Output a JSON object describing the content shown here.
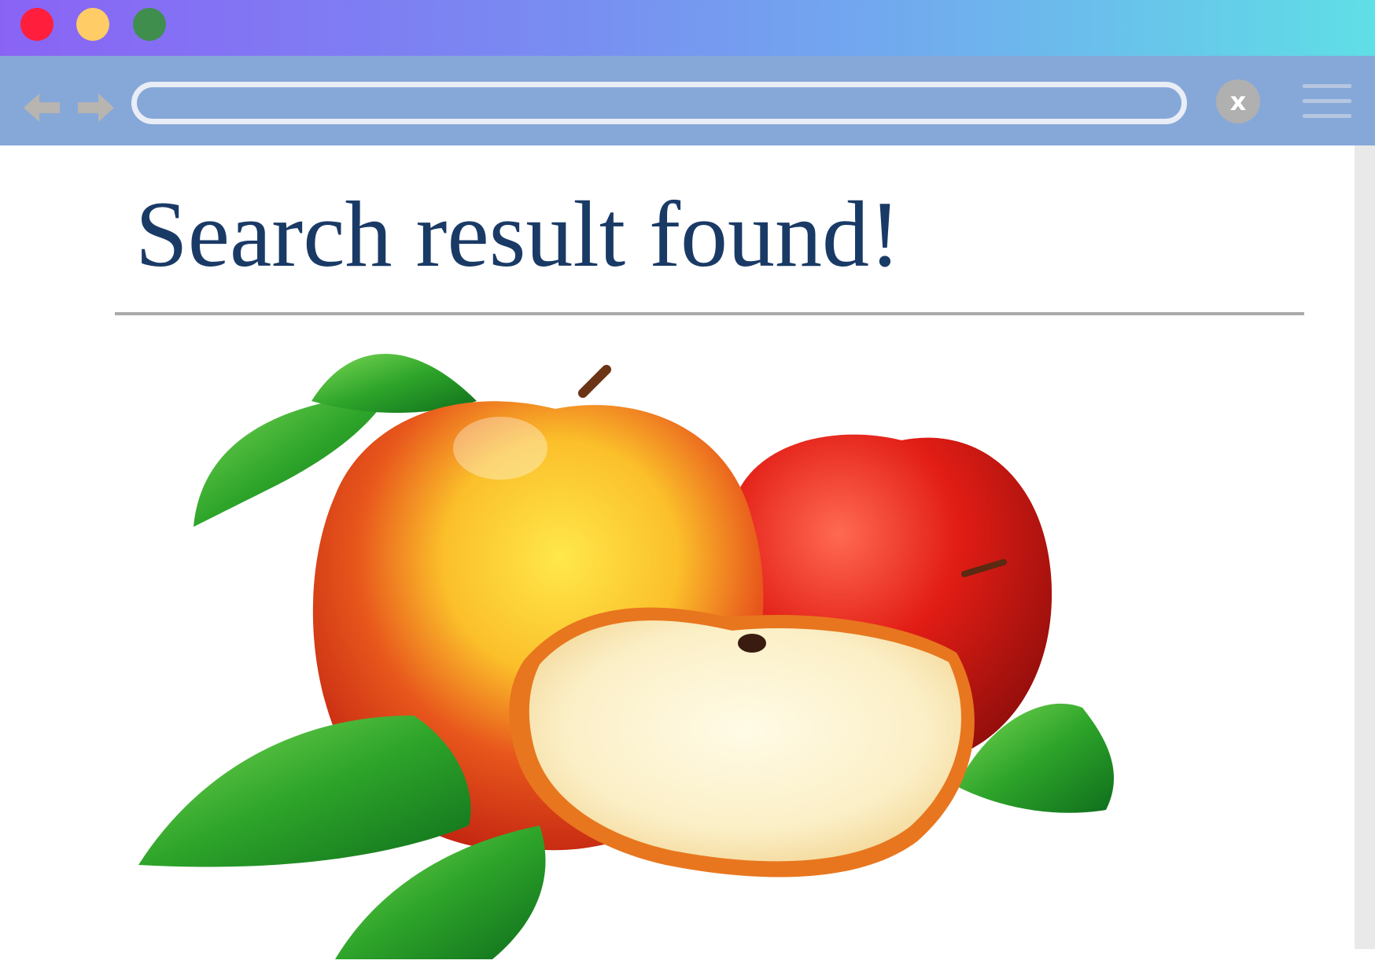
{
  "window": {
    "traffic_lights": {
      "close_color": "#ff1e3c",
      "minimize_color": "#ffcc66",
      "maximize_color": "#3f8e4d"
    },
    "gradient_colors": [
      "#8a63f5",
      "#5fdfe6"
    ]
  },
  "toolbar": {
    "back_icon": "arrow-left-icon",
    "forward_icon": "arrow-right-icon",
    "address_value": "",
    "clear_label": "x",
    "menu_icon": "hamburger-menu-icon",
    "background_color": "#86a8d8"
  },
  "page": {
    "title": "Search result found!",
    "title_color": "#1a3a66",
    "image": {
      "subject": "apples-with-leaves-and-slice"
    }
  }
}
